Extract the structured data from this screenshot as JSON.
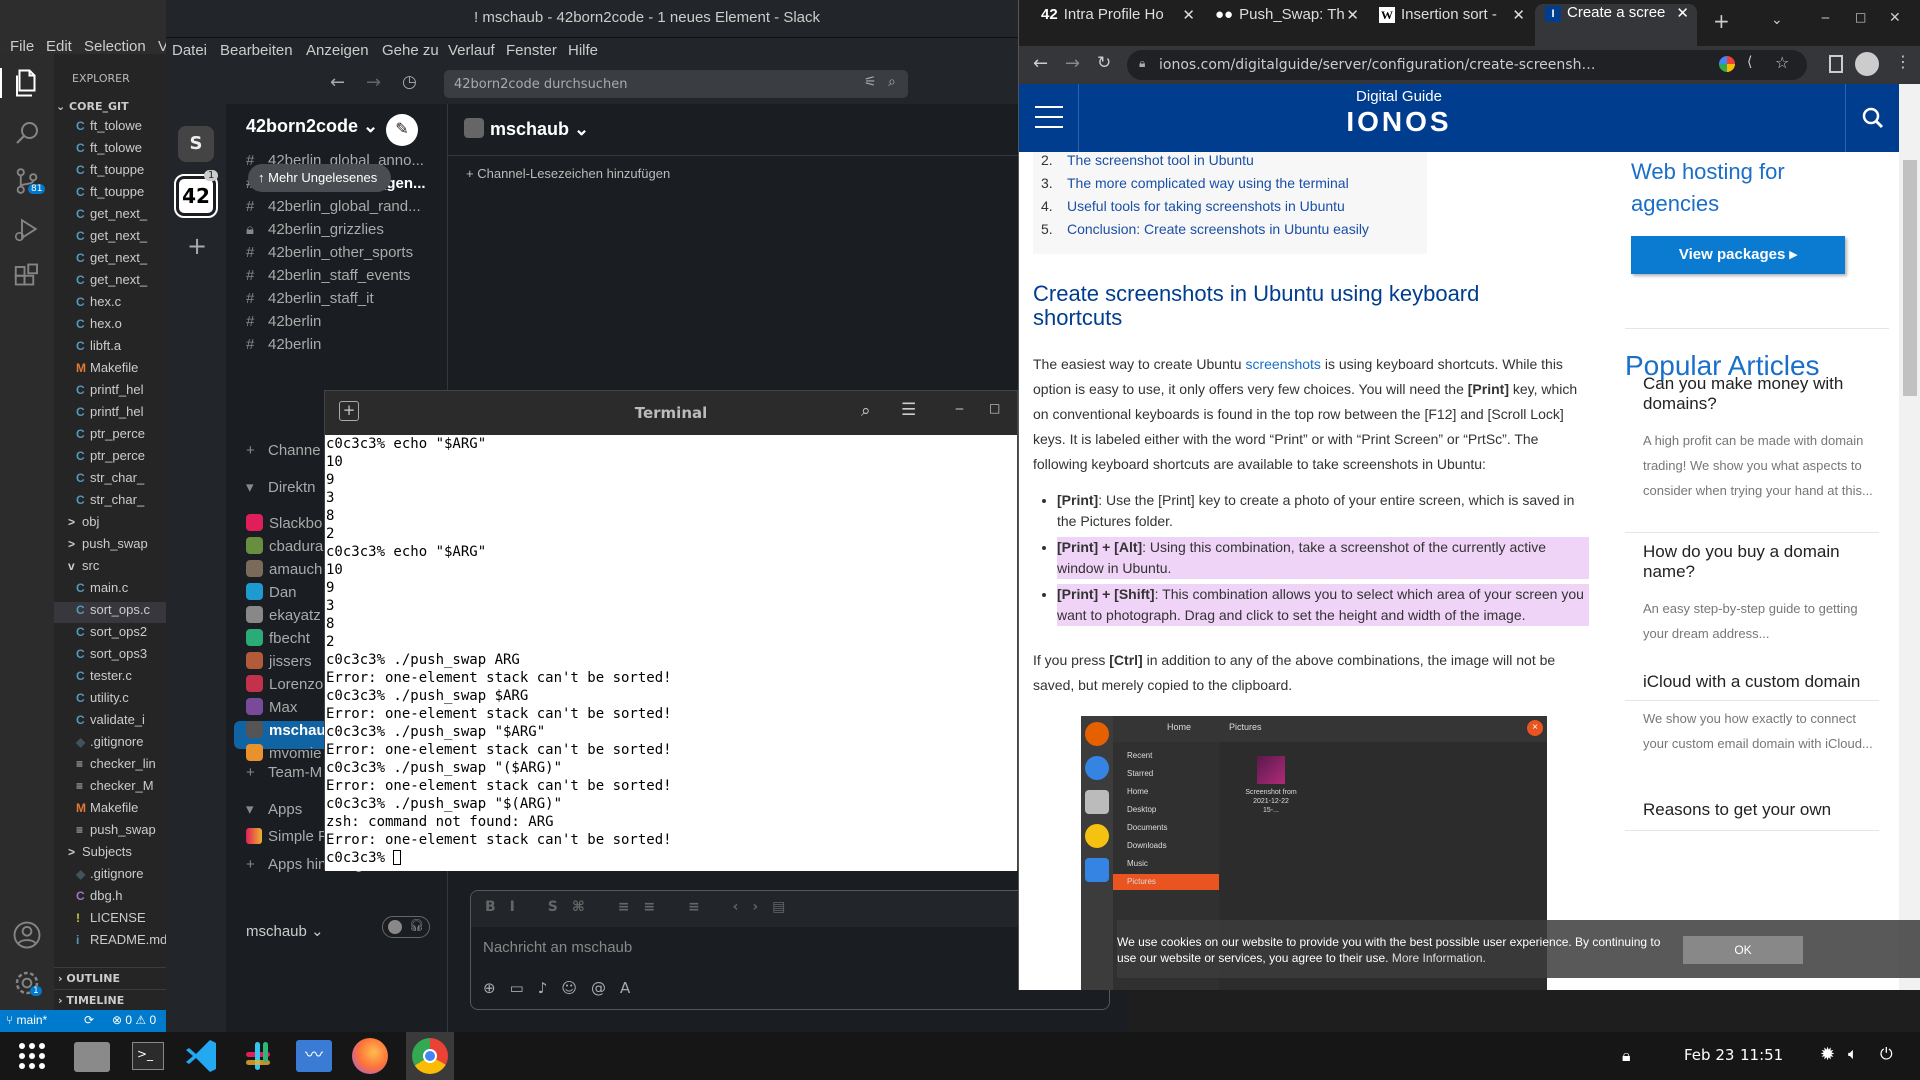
{
  "vscode": {
    "menu": [
      "File",
      "Edit",
      "Selection",
      "V"
    ],
    "explorer_title": "EXPLORER",
    "root_folder": "CORE_GIT",
    "files": [
      {
        "name": "ft_tolowe",
        "icon": "C",
        "color": "#519aba",
        "kind": "file"
      },
      {
        "name": "ft_tolowe",
        "icon": "C",
        "color": "#519aba",
        "kind": "file"
      },
      {
        "name": "ft_touppe",
        "icon": "C",
        "color": "#519aba",
        "kind": "file"
      },
      {
        "name": "ft_touppe",
        "icon": "C",
        "color": "#519aba",
        "kind": "file"
      },
      {
        "name": "get_next_",
        "icon": "C",
        "color": "#519aba",
        "kind": "file"
      },
      {
        "name": "get_next_",
        "icon": "C",
        "color": "#519aba",
        "kind": "file"
      },
      {
        "name": "get_next_",
        "icon": "C",
        "color": "#519aba",
        "kind": "file"
      },
      {
        "name": "get_next_",
        "icon": "C",
        "color": "#519aba",
        "kind": "file"
      },
      {
        "name": "hex.c",
        "icon": "C",
        "color": "#519aba",
        "kind": "file"
      },
      {
        "name": "hex.o",
        "icon": "C",
        "color": "#519aba",
        "kind": "file"
      },
      {
        "name": "libft.a",
        "icon": "C",
        "color": "#519aba",
        "kind": "file"
      },
      {
        "name": "Makefile",
        "icon": "M",
        "color": "#e37933",
        "kind": "file"
      },
      {
        "name": "printf_hel",
        "icon": "C",
        "color": "#519aba",
        "kind": "file"
      },
      {
        "name": "printf_hel",
        "icon": "C",
        "color": "#519aba",
        "kind": "file"
      },
      {
        "name": "ptr_perce",
        "icon": "C",
        "color": "#519aba",
        "kind": "file"
      },
      {
        "name": "ptr_perce",
        "icon": "C",
        "color": "#519aba",
        "kind": "file"
      },
      {
        "name": "str_char_",
        "icon": "C",
        "color": "#519aba",
        "kind": "file"
      },
      {
        "name": "str_char_",
        "icon": "C",
        "color": "#519aba",
        "kind": "file"
      },
      {
        "name": "obj",
        "icon": ">",
        "color": "#ccc",
        "kind": "folder"
      },
      {
        "name": "push_swap",
        "icon": ">",
        "color": "#ccc",
        "kind": "folder"
      },
      {
        "name": "src",
        "icon": "v",
        "color": "#ccc",
        "kind": "folder"
      },
      {
        "name": "main.c",
        "icon": "C",
        "color": "#519aba",
        "kind": "file"
      },
      {
        "name": "sort_ops.c",
        "icon": "C",
        "color": "#519aba",
        "kind": "file"
      },
      {
        "name": "sort_ops2",
        "icon": "C",
        "color": "#519aba",
        "kind": "file"
      },
      {
        "name": "sort_ops3",
        "icon": "C",
        "color": "#519aba",
        "kind": "file"
      },
      {
        "name": "tester.c",
        "icon": "C",
        "color": "#519aba",
        "kind": "file"
      },
      {
        "name": "utility.c",
        "icon": "C",
        "color": "#519aba",
        "kind": "file"
      },
      {
        "name": "validate_i",
        "icon": "C",
        "color": "#519aba",
        "kind": "file"
      },
      {
        "name": ".gitignore",
        "icon": "◆",
        "color": "#41535b",
        "kind": "file"
      },
      {
        "name": "checker_lin",
        "icon": "≡",
        "color": "#ccc",
        "kind": "file"
      },
      {
        "name": "checker_M",
        "icon": "≡",
        "color": "#ccc",
        "kind": "file"
      },
      {
        "name": "Makefile",
        "icon": "M",
        "color": "#e37933",
        "kind": "file"
      },
      {
        "name": "push_swap",
        "icon": "≡",
        "color": "#ccc",
        "kind": "file"
      },
      {
        "name": "Subjects",
        "icon": ">",
        "color": "#ccc",
        "kind": "folder"
      },
      {
        "name": ".gitignore",
        "icon": "◆",
        "color": "#41535b",
        "kind": "file"
      },
      {
        "name": "dbg.h",
        "icon": "C",
        "color": "#a074c4",
        "kind": "file"
      },
      {
        "name": "LICENSE",
        "icon": "!",
        "color": "#cbcb41",
        "kind": "file"
      },
      {
        "name": "README.md",
        "icon": "i",
        "color": "#519aba",
        "kind": "file"
      }
    ],
    "outline": "OUTLINE",
    "timeline": "TIMELINE",
    "badge_count": "81",
    "settings_badge": "1",
    "status": {
      "branch": "main*",
      "errors": "0",
      "warnings": "0"
    }
  },
  "slack": {
    "window_title": "! mschaub - 42born2code - 1 neues Element - Slack",
    "menu": [
      "Datei",
      "Bearbeiten",
      "Anzeigen",
      "Gehe zu",
      "Verlauf",
      "Fenster",
      "Hilfe"
    ],
    "search_placeholder": "42born2code durchsuchen",
    "workspace": "42born2code",
    "rail_badge": "1",
    "unread_pill": "Mehr Ungelesenes",
    "channels": [
      {
        "name": "42berlin_global_anno...",
        "bold": false,
        "icon": "#"
      },
      {
        "name": "42berlin_global_gen...",
        "bold": true,
        "icon": "#"
      },
      {
        "name": "42berlin_global_rand...",
        "bold": false,
        "icon": "#"
      },
      {
        "name": "42berlin_grizzlies",
        "bold": false,
        "icon": "lock"
      },
      {
        "name": "42berlin_other_sports",
        "bold": false,
        "icon": "#"
      },
      {
        "name": "42berlin_staff_events",
        "bold": false,
        "icon": "#"
      },
      {
        "name": "42berlin_staff_it",
        "bold": false,
        "icon": "#"
      },
      {
        "name": "42berlin",
        "bold": false,
        "icon": "#"
      },
      {
        "name": "42berlin",
        "bold": false,
        "icon": "#"
      }
    ],
    "add_channel": "Channe",
    "dm_header": "Direktn",
    "dms": [
      {
        "name": "Slackbo",
        "color": "#e01e5a"
      },
      {
        "name": "cbadura",
        "color": "#6a8e3f"
      },
      {
        "name": "amauch",
        "color": "#7a6a5a"
      },
      {
        "name": "Dan",
        "color": "#1d9bd1"
      },
      {
        "name": "ekayatz",
        "color": "#888"
      },
      {
        "name": "fbecht",
        "color": "#2bac76"
      },
      {
        "name": "jissers",
        "color": "#b35a3a"
      },
      {
        "name": "Lorenzo",
        "color": "#c4314b"
      },
      {
        "name": "Max",
        "color": "#7a4a9a"
      },
      {
        "name": "mschau",
        "color": "#555",
        "active": true
      },
      {
        "name": "mvomie",
        "color": "#e8912d"
      }
    ],
    "add_team": "Team-M",
    "apps_header": "Apps",
    "apps": [
      "Simple Poll"
    ],
    "add_apps": "Apps hinzufügen",
    "user": "mschaub",
    "channel_header": "mschaub",
    "bookmark": "Channel-Lesezeichen hinzufügen",
    "composer_placeholder": "Nachricht an mschaub"
  },
  "terminal": {
    "title": "Terminal",
    "lines": [
      "c0c3c3% echo \"$ARG\"",
      "10",
      "9",
      "3",
      "8",
      "2",
      "c0c3c3% echo \"$ARG\"",
      "10",
      "9",
      "3",
      "8",
      "2",
      "c0c3c3% ./push_swap ARG",
      "Error: one-element stack can't be sorted!",
      "c0c3c3% ./push_swap $ARG",
      "Error: one-element stack can't be sorted!",
      "c0c3c3% ./push_swap \"$ARG\"",
      "Error: one-element stack can't be sorted!",
      "c0c3c3% ./push_swap \"($ARG)\"",
      "Error: one-element stack can't be sorted!",
      "c0c3c3% ./push_swap \"$(ARG)\"",
      "zsh: command not found: ARG",
      "Error: one-element stack can't be sorted!",
      "c0c3c3% "
    ]
  },
  "chrome": {
    "tabs": [
      {
        "label": "Intra Profile Ho",
        "icon": "42"
      },
      {
        "label": "Push_Swap: Th",
        "icon": "med"
      },
      {
        "label": "Insertion sort -",
        "icon": "W"
      },
      {
        "label": "Create a scree",
        "icon": "I",
        "active": true
      }
    ],
    "url": "ionos.com/digitalguide/server/configuration/create-screenshot-in-ubuntu/#:~:text=%...",
    "site_title": "Digital Guide",
    "site_logo": "IONOS",
    "toc": [
      {
        "num": "2.",
        "text": "The screenshot tool in Ubuntu"
      },
      {
        "num": "3.",
        "text": "The more complicated way using the terminal"
      },
      {
        "num": "4.",
        "text": "Useful tools for taking screenshots in Ubuntu"
      },
      {
        "num": "5.",
        "text": "Conclusion: Create screenshots in Ubuntu easily"
      }
    ],
    "heading": "Create screenshots in Ubuntu using keyboard shortcuts",
    "para1_a": "The easiest way to create Ubuntu ",
    "para1_link": "screenshots",
    "para1_b": " is using keyboard shortcuts. While this option is easy to use, it only offers very few choices. You will need the ",
    "para1_key": "[Print]",
    "para1_c": " key, which on conventional keyboards is found in the top row between the [F12] and [Scroll Lock] keys. It is labeled either with the word “Print” or with “Print Screen” or “PrtSc”. The following keyboard shortcuts are available to take screenshots in Ubuntu:",
    "bullets": [
      {
        "key": "[Print]",
        "text": ": Use the [Print] key to create a photo of your entire screen, which is saved in the Pictures folder.",
        "hl": false
      },
      {
        "key": "[Print] + [Alt]",
        "text": ": Using this combination, take a screenshot of the currently active window in Ubuntu.",
        "hl": true
      },
      {
        "key": "[Print] + [Shift]",
        "text": ": This combination allows you to select which area of your screen you want to photograph. Drag and click to set the height and width of the image.",
        "hl": true
      }
    ],
    "para2_a": "If you press ",
    "para2_key": "[Ctrl]",
    "para2_b": " in addition to any of the above combinations, the image will not be saved, but merely copied to the clipboard.",
    "fm": {
      "crumbs": [
        "Home",
        "Pictures"
      ],
      "places": [
        "Recent",
        "Starred",
        "Home",
        "Desktop",
        "Documents",
        "Downloads",
        "Music",
        "Pictures"
      ],
      "file": "Screenshot from 2021-12-22 15-..."
    },
    "sidebar_ad": "Web hosting for agencies",
    "sidebar_btn": "View packages",
    "popular_title": "Popular Articles",
    "articles": [
      {
        "title": "Can you make money with domains?",
        "desc": "A high profit can be made with domain trading! We show you what aspects to consider when trying your hand at this..."
      },
      {
        "title": "How do you buy a domain name?",
        "desc": "An easy step-by-step guide to getting your dream address..."
      },
      {
        "title": "iCloud with a custom domain",
        "desc": "We show you how exactly to connect your custom email domain with iCloud..."
      },
      {
        "title": "Reasons to get your own",
        "desc": ""
      }
    ],
    "cookie_text": "We use cookies on our website to provide you with the best possible user experience. By continuing to use our website or services, you agree to their use.",
    "cookie_link": "More Information.",
    "cookie_ok": "OK"
  },
  "taskbar": {
    "date": "Feb 23",
    "time": "11:51"
  }
}
